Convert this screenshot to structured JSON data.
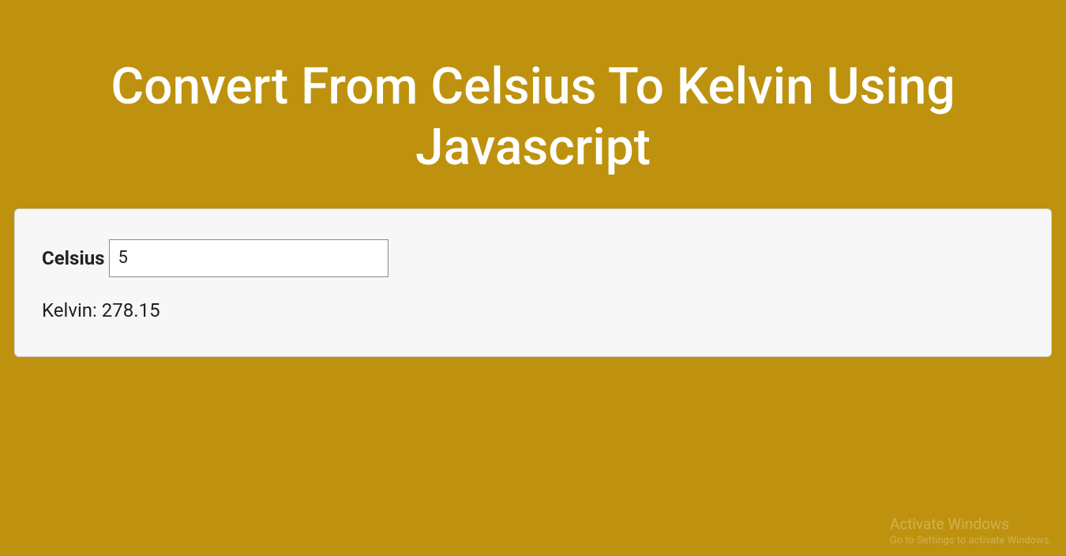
{
  "header": {
    "title": "Convert From Celsius To Kelvin Using Javascript"
  },
  "converter": {
    "input_label": "Celsius",
    "input_value": "5",
    "result_text": "Kelvin: 278.15"
  },
  "watermark": {
    "title": "Activate Windows",
    "subtitle": "Go to Settings to activate Windows."
  }
}
